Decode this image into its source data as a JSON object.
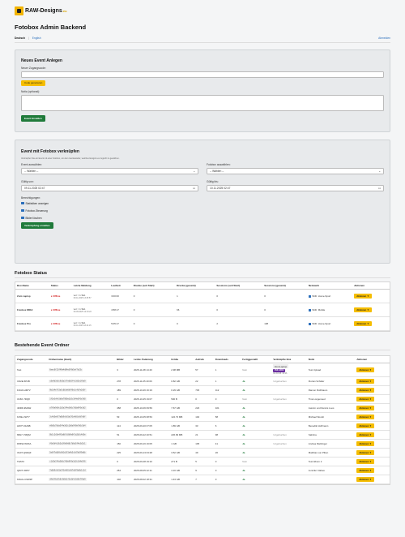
{
  "logo": {
    "name": "RAW-Designs",
    "tld": ".eu"
  },
  "page_title": "Fotobox Admin Backend",
  "lang": {
    "de": "Deutsch",
    "sep": "|",
    "en": "English"
  },
  "logout": "Abmelden",
  "new_event": {
    "heading": "Neues Event Anlegen",
    "code_label": "Neuer Zugangscode:",
    "code_value": "",
    "generate_button": "Code generieren",
    "note_label": "Notiz (optional):",
    "note_value": "",
    "create_button": "Event Erstellen"
  },
  "link_event": {
    "heading": "Event mit Fotobox verknüpfen",
    "hint": "Verknüpfen Sie ein Event mit einer Fotobox, um dem Gerätesteller, welches Ereignis es zugreift zu gewähren.",
    "event_label": "Event auswählen:",
    "event_value": "-- Wählen --",
    "box_label": "Fotobox auswählen:",
    "box_value": "-- Wählen --",
    "from_label": "Gültig von:",
    "from_value": "09.11.2025 02:47",
    "to_label": "Gültig bis:",
    "to_value": "10.11.2025 02:47",
    "perm_label": "Berechtigungen:",
    "perms": [
      "Statistiken anzeigen",
      "Fotobox-Steuerung",
      "Bilder löschen"
    ],
    "link_button": "Verknüpfung erstellen"
  },
  "status": {
    "heading": "Fotobox Status",
    "columns": [
      "Box-Name",
      "Status",
      "Letzte Meldung",
      "Laufzeit",
      "Drucke (seit Start)",
      "Drucke (gesamt)",
      "Sessions (seit Start)",
      "Sessions (gesamt)",
      "Netzwerk",
      "Aktionen"
    ],
    "rows": [
      {
        "name": "Zoni-Laptop",
        "status": "● Offline",
        "last": "vor > 1 Std.",
        "last_sub": "09.11.2025 13:25:57",
        "uptime": "3:00:00",
        "p_start": "0",
        "p_total": "1",
        "s_start": "0",
        "s_total": "0",
        "net": "WiFi: Home-Sport",
        "action": "Aktionen ▼"
      },
      {
        "name": "Fotobox RRHI",
        "status": "● Offline",
        "last": "vor > 1 Std.",
        "last_sub": "09.09.2025 12:43:23",
        "uptime": "4:58:17",
        "p_start": "0",
        "p_total": "66",
        "s_start": "0",
        "s_total": "0",
        "net": "WiFi: Mobile",
        "action": "Aktionen ▼"
      },
      {
        "name": "Fotobox Pro",
        "status": "● Offline",
        "last": "vor > 1 Std.",
        "last_sub": "09.11.2025 18:44:15",
        "uptime": "5:05:17",
        "p_start": "0",
        "p_total": "0",
        "s_start": "2",
        "s_total": "138",
        "net": "WiFi: Home-Sport",
        "action": "Aktionen ▼"
      }
    ]
  },
  "events": {
    "heading": "Bestehende Event Ordner",
    "columns": [
      "Zugangscode",
      "Ordnername (Hash)",
      "Bilder",
      "Letzte Änderung",
      "Größe",
      "Aufrufe",
      "Downloads",
      "Fertiggestellt",
      "Verknüpfte Box",
      "Notiz",
      "Aktionen"
    ],
    "rows": [
      {
        "code": "Test",
        "hash": "6eec0f23f49e4d84e5f9d5ef7e23c",
        "imgs": "3",
        "date": "2025-11-08 14:40",
        "size": "2.98 MB",
        "views": "57",
        "dl": "1",
        "done": "Nein",
        "box": "Zoni-Laptop",
        "box_badge": "FSK 18/00",
        "box_sub": "bis 10.08. 10:26",
        "note": "Test Upload",
        "action": "Aktionen ▼"
      },
      {
        "code": "CD2E-5P2B",
        "hash": "c8a4b3e5c9d2a1f7e6b5f4c3d2e1f0a9",
        "imgs": "278",
        "date": "2025-11-05 20:06",
        "size": "0.82 GB",
        "views": "22",
        "dl": "1",
        "done": "Ja",
        "box": "Ungebuchen",
        "box_badge": "",
        "box_sub": "",
        "note": "Florian Schäfer",
        "action": "Aktionen ▼"
      },
      {
        "code": "F2GD-HM7V",
        "hash": "9b1d4e7f2a5c8b3e6d9f0a1c4b7e2d5f",
        "imgs": "189",
        "date": "2025-10-26 16:19",
        "size": "0.29 GB",
        "views": "745",
        "dl": "112",
        "done": "Ja",
        "box": "",
        "box_badge": "",
        "box_sub": "",
        "note": "Ramon Rothbaum",
        "action": "Aktionen ▼"
      },
      {
        "code": "3U6X-7RQ8",
        "hash": "1f2e3d4c5b6a7980a1b2c3d4e5f6a7b8",
        "imgs": "0",
        "date": "2025-10-25 19:07",
        "size": "500 B",
        "views": "0",
        "dl": "0",
        "done": "Nein",
        "box": "Ungebuchen",
        "box_badge": "",
        "box_sub": "",
        "note": "Tina Longenued",
        "action": "Aktionen ▼"
      },
      {
        "code": "4DRK-9MAW",
        "hash": "a7f8e9d0c1b2a3f4e5d6c7b8a9f0e1d2",
        "imgs": "458",
        "date": "2025-10-06 09:59",
        "size": "7.67 GB",
        "views": "223",
        "dl": "321",
        "done": "Ja",
        "box": "",
        "box_badge": "",
        "box_sub": "",
        "note": "Jasmin und Dennis Loos",
        "action": "Aktionen ▼"
      },
      {
        "code": "KJ5E-VW77",
        "hash": "3c4d5e6f7a8b9c0d1e2f3a4b5c6d7e8f",
        "imgs": "53",
        "date": "2025-10-05 08:53",
        "size": "122.73 MB",
        "views": "102",
        "dl": "58",
        "done": "Ja",
        "box": "",
        "box_badge": "",
        "box_sub": "",
        "note": "Michael Wendt",
        "action": "Aktionen ▼"
      },
      {
        "code": "HW7Y-9HSB",
        "hash": "e9d8c7b6a5f4e3d2c1b0a9f8e7d6c5b4",
        "imgs": "114",
        "date": "2025-09-20 07:05",
        "size": "1.89 GB",
        "views": "33",
        "dl": "6",
        "done": "Ja",
        "box": "",
        "box_badge": "",
        "box_sub": "",
        "note": "Benedikt Hoffmann",
        "action": "Aktionen ▼"
      },
      {
        "code": "6B17-YMQM",
        "hash": "0b1c2d3e4f5a6b7c8d9e0f1a2b3c4d5e",
        "imgs": "51",
        "date": "2025-09-22 20:51",
        "size": "226.99 MB",
        "views": "21",
        "dl": "98",
        "done": "Ja",
        "box": "Ungebuchen",
        "box_badge": "",
        "box_sub": "",
        "note": "Sabrina",
        "action": "Aktionen ▼"
      },
      {
        "code": "D8KW-W9XA",
        "hash": "f6e5d4c3b2a1f0e9d8c7b6a5f4e3d2c1",
        "imgs": "150",
        "date": "2025-09-16 16:05",
        "size": "1 GB",
        "views": "105",
        "dl": "41",
        "done": "Ja",
        "box": "Ungebuchen",
        "box_badge": "",
        "box_sub": "",
        "note": "Andrea Rieblinger",
        "action": "Aktionen ▼"
      },
      {
        "code": "3G07-Q9ZQF",
        "hash": "5e6f7a8b9c0d1e2f3a4b5c6d7e8f9a0b",
        "imgs": "225",
        "date": "2025-09-13 03:28",
        "size": "3.52 GB",
        "views": "49",
        "dl": "26",
        "done": "Ja",
        "box": "",
        "box_badge": "",
        "box_sub": "",
        "note": "Matthias von Pilten",
        "action": "Aktionen ▼"
      },
      {
        "code": "TEST2",
        "hash": "c1d2e3f4a5b6c7d8e9f0a1b2c3d4e5f6",
        "imgs": "0",
        "date": "2025-06-08 19:10",
        "size": "271 B",
        "views": "5",
        "dl": "0",
        "done": "Nein",
        "box": "",
        "box_badge": "",
        "box_sub": "",
        "note": "Test Album 2",
        "action": "Aktionen ▼"
      },
      {
        "code": "Q8VT-XR57",
        "hash": "7a8b9c0d1e2f3a4b5c6d7e8f9a0b1c2d",
        "imgs": "254",
        "date": "2025-08-05 22:11",
        "size": "4.16 GB",
        "views": "9",
        "dl": "0",
        "done": "Ja",
        "box": "",
        "box_badge": "",
        "box_sub": "",
        "note": "Jennifer Clabes",
        "action": "Aktionen ▼"
      },
      {
        "code": "KDAG-C9W2P",
        "hash": "d4e5f6a7b8c9d0e1f2a3b4c5d6e7f8a9",
        "imgs": "102",
        "date": "2025-08-02 18:31",
        "size": "1.43 GB",
        "views": "7",
        "dl": "0",
        "done": "Ja",
        "box": "",
        "box_badge": "",
        "box_sub": "",
        "note": "",
        "action": "Aktionen ▼"
      }
    ]
  }
}
